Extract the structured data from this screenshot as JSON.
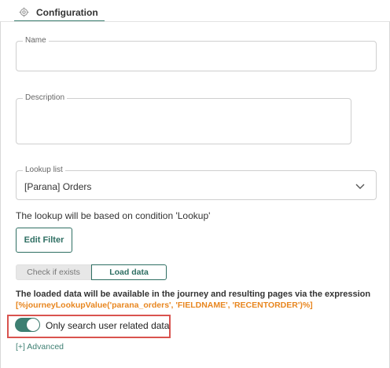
{
  "tabs": {
    "config_label": "Configuration"
  },
  "fields": {
    "name_label": "Name",
    "description_label": "Description",
    "lookup_list_label": "Lookup list",
    "lookup_list_value": "[Parana] Orders"
  },
  "lookup_hint": "The lookup will be based on condition 'Lookup'",
  "edit_filter_label": "Edit Filter",
  "mode_buttons": {
    "check_label": "Check if exists",
    "load_label": "Load data",
    "selected": "Load data"
  },
  "info_text": "The loaded data will be available in the journey and resulting pages via the expression",
  "expression": "[%journeyLookupValue('parana_orders', 'FIELDNAME', 'RECENTORDER')%]",
  "toggle": {
    "label": "Only search user related data",
    "on": true
  },
  "advanced_label": "[+] Advanced",
  "colors": {
    "accent": "#3d7f72",
    "expression": "#e8861f",
    "highlight": "#d9534f"
  },
  "icons": {
    "tab": "gear-icon",
    "select": "chevron-down-icon"
  }
}
